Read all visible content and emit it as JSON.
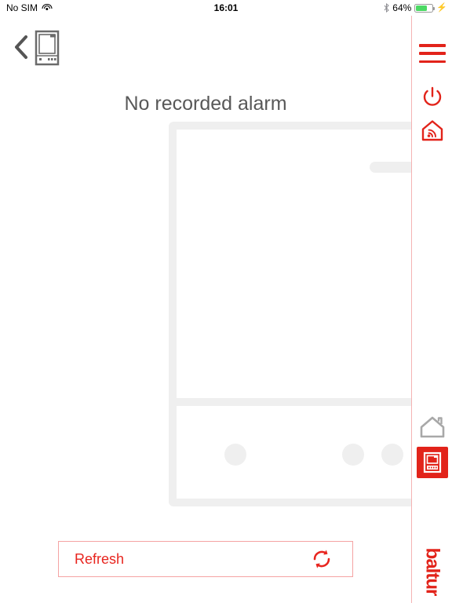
{
  "status_bar": {
    "carrier": "No SIM",
    "wifi_icon": "wifi-icon",
    "time": "16:01",
    "bluetooth_icon": "bluetooth-icon",
    "battery_percent": "64%",
    "battery_level": 64,
    "battery_charging": true,
    "battery_color": "#4cd964"
  },
  "header": {
    "back_icon": "chevron-left-icon",
    "device_icon": "burner-device-icon"
  },
  "main": {
    "title": "No recorded alarm",
    "device_panel": {
      "name": "device-illustration-panel",
      "tab_name": "panel-display-tab",
      "dots": [
        "panel-dot-1",
        "panel-dot-2",
        "panel-dot-3"
      ]
    },
    "refresh_button": {
      "label": "Refresh",
      "icon": "refresh-icon"
    }
  },
  "right_rail": {
    "menu_icon": "hamburger-menu-icon",
    "power_icon": "power-icon",
    "home_wifi_icon": "home-wifi-icon",
    "home_icon": "home-icon",
    "device_icon": "burner-device-icon",
    "logo_text": "baltur"
  },
  "colors": {
    "brand_red": "#e2231a",
    "accent_red": "#e8251f",
    "divider_pink": "#f5b3b3",
    "placeholder_gray": "#efefef",
    "title_gray": "#585858"
  }
}
